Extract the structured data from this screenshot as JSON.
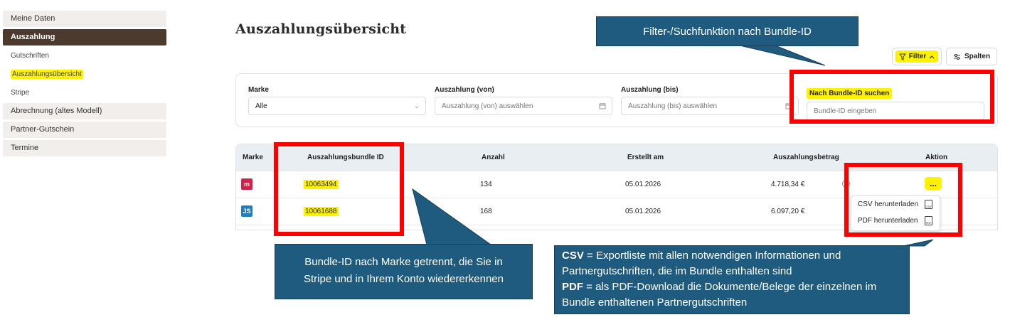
{
  "sidebar": {
    "items": [
      {
        "label": "Meine Daten"
      },
      {
        "label": "Auszahlung"
      },
      {
        "label": "Gutschriften"
      },
      {
        "label": "Auszahlungsübersicht"
      },
      {
        "label": "Stripe"
      },
      {
        "label": "Abrechnung (altes Modell)"
      },
      {
        "label": "Partner-Gutschein"
      },
      {
        "label": "Termine"
      }
    ]
  },
  "page": {
    "title": "Auszahlungsübersicht"
  },
  "toolbar": {
    "filter_label": "Filter",
    "columns_label": "Spalten"
  },
  "filters": {
    "brand_label": "Marke",
    "brand_value": "Alle",
    "from_label": "Auszahlung (von)",
    "from_placeholder": "Auszahlung (von) auswählen",
    "to_label": "Auszahlung (bis)",
    "to_placeholder": "Auszahlung (bis) auswählen",
    "bundle_label": "Nach Bundle-ID suchen",
    "bundle_placeholder": "Bundle-ID eingeben"
  },
  "table": {
    "columns": [
      "Marke",
      "Auszahlungsbundle ID",
      "Anzahl",
      "Erstellt am",
      "Auszahlungsbetrag",
      "Aktion"
    ],
    "rows": [
      {
        "brand": "m",
        "brand_color": "#d0234a",
        "bundle_id": "10063494",
        "count": "134",
        "created": "05.01.2026",
        "amount": "4.718,34 €",
        "action": "..."
      },
      {
        "brand": "JS",
        "brand_color": "#1f7fc1",
        "bundle_id": "10061688",
        "count": "168",
        "created": "05.01.2026",
        "amount": "6.097,20 €",
        "action": ""
      }
    ]
  },
  "menu": {
    "csv": "CSV herunterladen",
    "csv_icon": "CSV",
    "pdf": "PDF herunterladen",
    "pdf_icon": "PDF"
  },
  "callouts": {
    "filter": "Filter-/Suchfunktion nach Bundle-ID",
    "bundle_line1": "Bundle-ID nach Marke getrennt, die Sie in",
    "bundle_line2": "Stripe und in Ihrem Konto wiedererkennen",
    "csv_key": "CSV",
    "csv_text": " = Exportliste mit allen notwendigen Informationen und Partnergutschriften, die im Bundle enthalten sind",
    "pdf_key": "PDF",
    "pdf_text": " = als PDF-Download die Dokumente/Belege der einzelnen im Bundle enthaltenen Partnergutschriften"
  },
  "colors": {
    "active": "#4c3a2f",
    "highlight": "#fff200",
    "callout": "#1e5b7e",
    "annotation": "#ff0000"
  }
}
